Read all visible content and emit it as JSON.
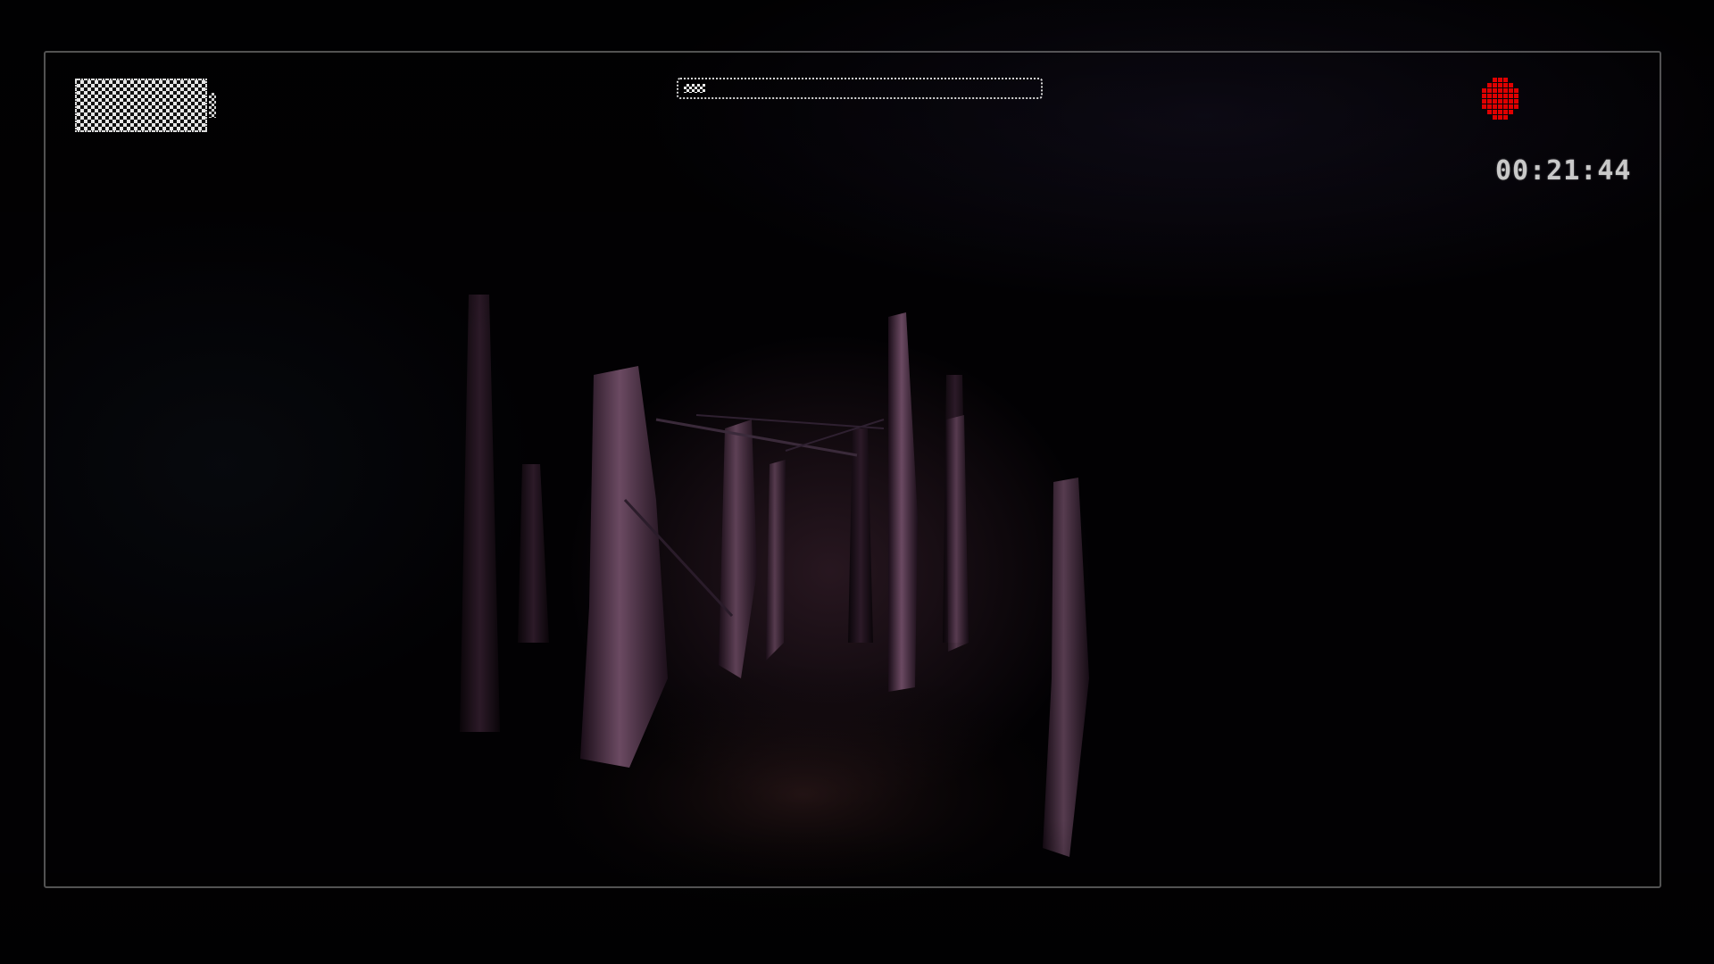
{
  "game": {
    "scene": "dark-forest-night",
    "hud": {
      "battery": {
        "icon": "battery-icon",
        "level": 1.0,
        "color": "#e6e6e6"
      },
      "top_bar": {
        "icon": "stamina-bar",
        "fill": 0.06,
        "color": "#ececec"
      },
      "record": {
        "icon": "record-dot-icon",
        "color": "#e00000"
      },
      "timecode": "00:21:44"
    }
  }
}
